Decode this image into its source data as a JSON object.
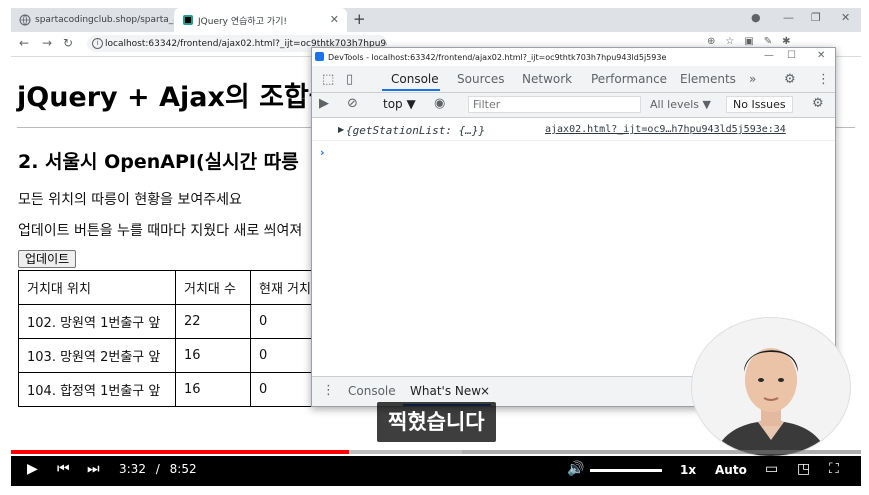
{
  "browser": {
    "tabs": [
      {
        "title": "spartacodingclub.shop/sparta_a",
        "active": false
      },
      {
        "title": "JQuery 연습하고 가기!",
        "active": true
      }
    ],
    "address": "localhost:63342/frontend/ajax02.html?_ijt=oc9thtk703h7hpu943ld5j593e"
  },
  "page": {
    "h1": "jQuery + Ajax의 조합을",
    "h2": "2. 서울시 OpenAPI(실시간 따릉",
    "p1": "모든 위치의 따릉이 현황을 보여주세요",
    "p2": "업데이트 버튼을 누를 때마다 지웠다 새로 씌여져",
    "update_button": "업데이트",
    "table": {
      "headers": [
        "거치대 위치",
        "거치대 수",
        "현재 거치"
      ],
      "rows": [
        [
          "102. 망원역 1번출구 앞",
          "22",
          "0"
        ],
        [
          "103. 망원역 2번출구 앞",
          "16",
          "0"
        ],
        [
          "104. 합정역 1번출구 앞",
          "16",
          "0"
        ]
      ]
    }
  },
  "devtools": {
    "title": "DevTools - localhost:63342/frontend/ajax02.html?_ijt=oc9thtk703h7hpu943ld5j593e",
    "tabs": [
      "Console",
      "Sources",
      "Network",
      "Performance",
      "Elements",
      "»"
    ],
    "context": "top ▼",
    "filter_placeholder": "Filter",
    "levels": "All levels ▼",
    "issues": "No Issues",
    "log_object": "{getStationList: {…}}",
    "log_source": "ajax02.html?_ijt=oc9…h7hpu943ld5j593e:34",
    "prompt": "›",
    "drawer_tabs": [
      "Console",
      "What's New"
    ],
    "drawer_close": "×"
  },
  "video": {
    "subtitle": "찍혔습니다",
    "current_time": "3:32",
    "separator": "/",
    "duration": "8:52",
    "speed": "1x",
    "quality": "Auto",
    "progress_fraction": 0.398,
    "buffered_fraction": 0.53
  },
  "colors": {
    "accent": "#1a73e8",
    "progress": "#ff0000",
    "player_bg": "#000000"
  }
}
